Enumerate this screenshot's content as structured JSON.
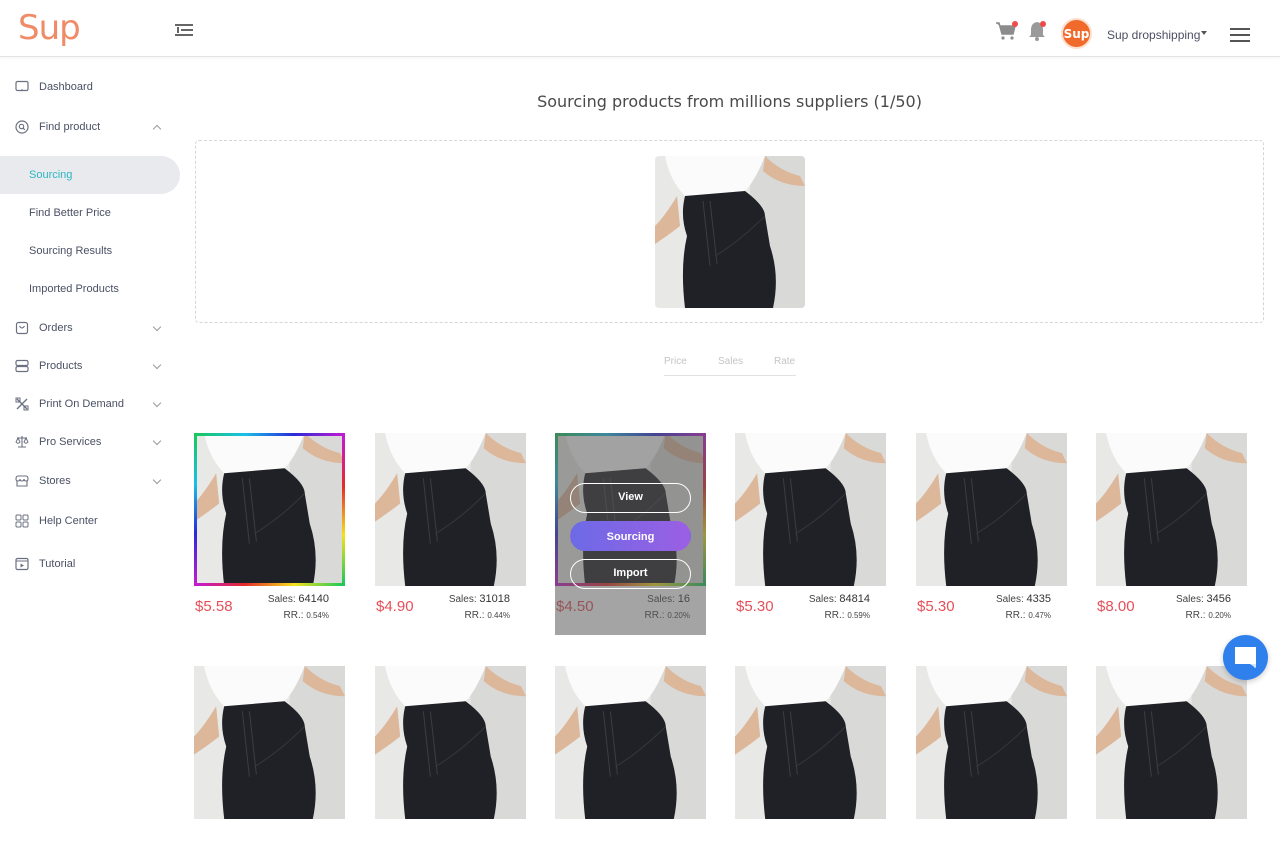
{
  "app": {
    "logo_text": "Sup"
  },
  "header": {
    "user_name": "Sup dropshipping",
    "avatar_text": "Sup",
    "colors": {
      "brand": "#f08b68",
      "notification_dot": "#ee4a4a",
      "avatar_bg": "#ef6a2b"
    }
  },
  "sidebar": {
    "items": [
      {
        "label": "Dashboard",
        "icon": "monitor-icon"
      },
      {
        "label": "Find product",
        "icon": "search-circle-icon",
        "expanded": true,
        "children": [
          {
            "label": "Sourcing",
            "active": true
          },
          {
            "label": "Find Better Price"
          },
          {
            "label": "Sourcing Results"
          },
          {
            "label": "Imported Products"
          }
        ]
      },
      {
        "label": "Orders",
        "icon": "bag-icon",
        "expanded": false
      },
      {
        "label": "Products",
        "icon": "server-icon",
        "expanded": false
      },
      {
        "label": "Print On Demand",
        "icon": "tools-icon",
        "expanded": false
      },
      {
        "label": "Pro Services",
        "icon": "scale-icon",
        "expanded": false
      },
      {
        "label": "Stores",
        "icon": "store-icon",
        "expanded": false
      },
      {
        "label": "Help Center",
        "icon": "grid-icon"
      },
      {
        "label": "Tutorial",
        "icon": "video-icon"
      }
    ],
    "active_color": "#2bb6c2"
  },
  "main": {
    "title": "Sourcing products from millions suppliers (1/50)",
    "sort_tabs": [
      "Price",
      "Sales",
      "Rate"
    ],
    "hover_actions": {
      "view": "View",
      "sourcing": "Sourcing",
      "import": "Import"
    },
    "products": [
      {
        "price": "$5.58",
        "sales_label": "Sales:",
        "sales": "64140",
        "rr_label": "RR.:",
        "rr": "0.54%",
        "highlighted": true
      },
      {
        "price": "$4.90",
        "sales_label": "Sales:",
        "sales": "31018",
        "rr_label": "RR.:",
        "rr": "0.44%"
      },
      {
        "price": "$4.50",
        "sales_label": "Sales:",
        "sales": "16",
        "rr_label": "RR.:",
        "rr": "0.20%",
        "hovered": true
      },
      {
        "price": "$5.30",
        "sales_label": "Sales:",
        "sales": "84814",
        "rr_label": "RR.:",
        "rr": "0.59%"
      },
      {
        "price": "$5.30",
        "sales_label": "Sales:",
        "sales": "4335",
        "rr_label": "RR.:",
        "rr": "0.47%"
      },
      {
        "price": "$8.00",
        "sales_label": "Sales:",
        "sales": "3456",
        "rr_label": "RR.:",
        "rr": "0.20%"
      }
    ],
    "price_color": "#e5505a",
    "primary_button_color": "#7c66e6"
  },
  "chat": {
    "icon": "chat-icon",
    "color": "#2f80ed"
  }
}
